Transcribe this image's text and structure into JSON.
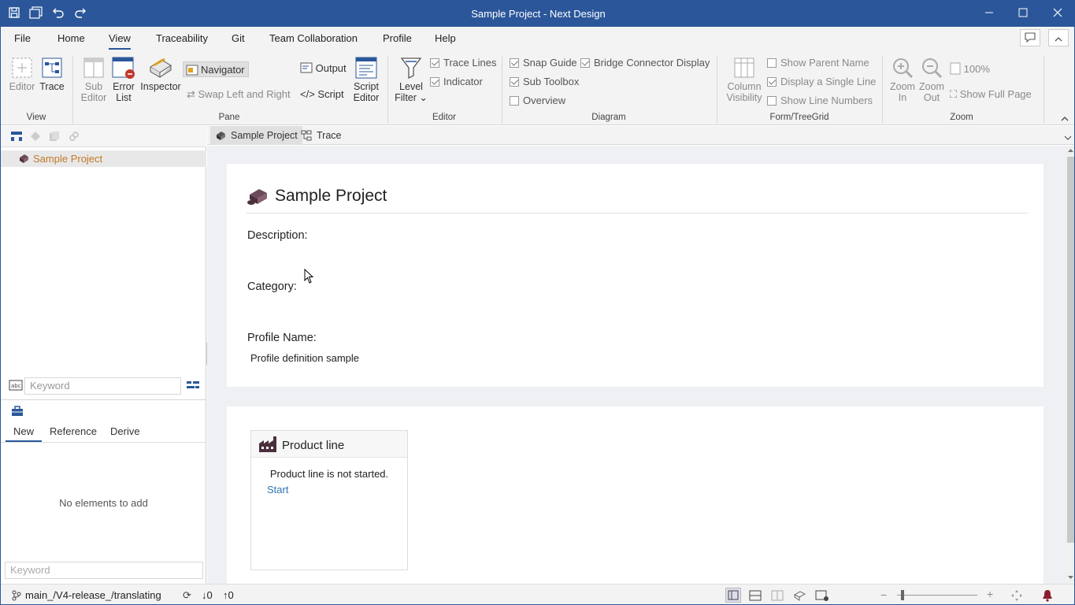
{
  "window": {
    "title": "Sample Project - Next Design"
  },
  "menu": [
    "File",
    "Home",
    "View",
    "Traceability",
    "Git",
    "Team Collaboration",
    "Profile",
    "Help"
  ],
  "menu_active": "View",
  "ribbon": {
    "view": {
      "editor": "Editor",
      "trace": "Trace",
      "group": "View"
    },
    "pane": {
      "sub_editor_1": "Sub",
      "sub_editor_2": "Editor",
      "error_list_1": "Error",
      "error_list_2": "List",
      "inspector": "Inspector",
      "navigator": "Navigator",
      "swap": "Swap Left and Right",
      "output": "Output",
      "script": "</> Script",
      "script_editor_1": "Script",
      "script_editor_2": "Editor",
      "group": "Pane"
    },
    "editor": {
      "level_filter_1": "Level",
      "level_filter_2": "Filter",
      "trace_lines": "Trace Lines",
      "indicator": "Indicator",
      "group": "Editor"
    },
    "diagram": {
      "snap_guide": "Snap Guide",
      "bridge_connector": "Bridge Connector Display",
      "sub_toolbox": "Sub Toolbox",
      "overview": "Overview",
      "group": "Diagram"
    },
    "form": {
      "column_visibility_1": "Column",
      "column_visibility_2": "Visibility",
      "show_parent_name": "Show Parent Name",
      "display_single_line": "Display a Single Line",
      "show_line_numbers": "Show Line Numbers",
      "group": "Form/TreeGrid"
    },
    "zoom": {
      "zoom_in_1": "Zoom",
      "zoom_in_2": "In",
      "zoom_out_1": "Zoom",
      "zoom_out_2": "Out",
      "level": "100%",
      "show_full_page": "Show Full Page",
      "group": "Zoom"
    }
  },
  "sidebar": {
    "tree_item": "Sample Project",
    "keyword_placeholder": "Keyword",
    "tabs": [
      "New",
      "Reference",
      "Derive"
    ],
    "empty_text": "No elements to add",
    "keyword2_placeholder": "Keyword"
  },
  "doc_tabs": [
    "Sample Project",
    "Trace"
  ],
  "project": {
    "title": "Sample Project",
    "description_label": "Description:",
    "category_label": "Category:",
    "profile_label": "Profile Name:",
    "profile_value": "Profile definition sample"
  },
  "product_line": {
    "title": "Product line",
    "status": "Product line is not started.",
    "start": "Start"
  },
  "status": {
    "branch": "main_/V4-release_/translating",
    "down_count": "0",
    "up_count": "0"
  },
  "colors": {
    "accent": "#2b579a",
    "tree_text": "#c07a2a",
    "link": "#2e75b6"
  }
}
